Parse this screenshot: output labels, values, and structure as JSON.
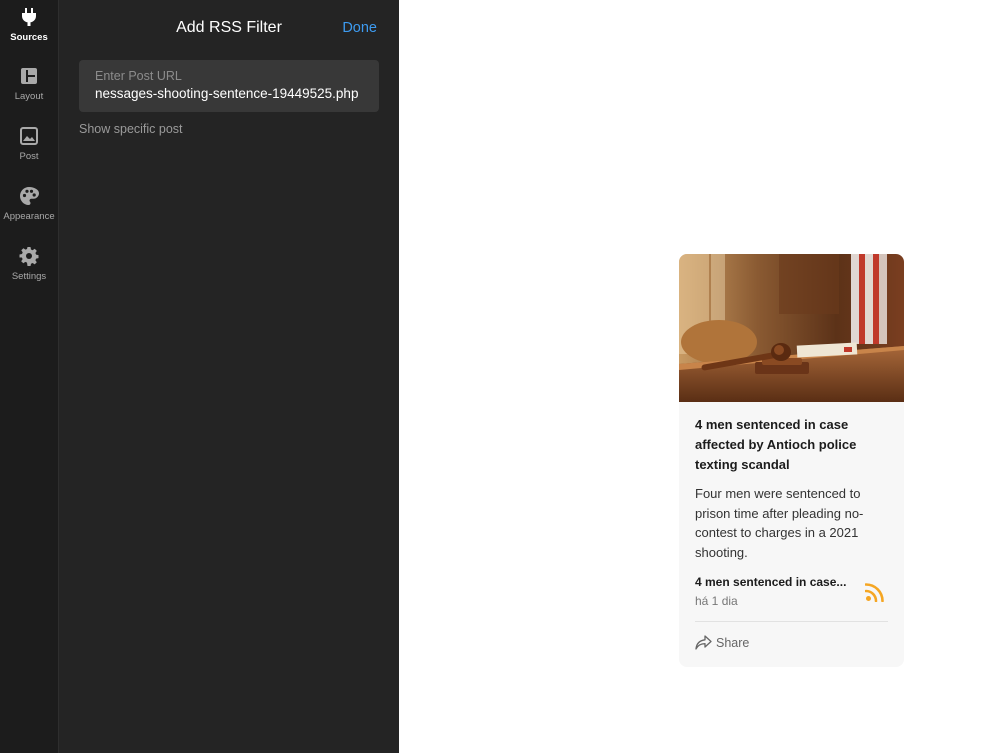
{
  "sidebar": {
    "items": [
      {
        "label": "Sources",
        "icon": "plug-icon",
        "active": true
      },
      {
        "label": "Layout",
        "icon": "layout-icon",
        "active": false
      },
      {
        "label": "Post",
        "icon": "image-icon",
        "active": false
      },
      {
        "label": "Appearance",
        "icon": "palette-icon",
        "active": false
      },
      {
        "label": "Settings",
        "icon": "gear-icon",
        "active": false
      }
    ]
  },
  "panel": {
    "title": "Add RSS Filter",
    "done_label": "Done",
    "url_field": {
      "label": "Enter Post URL",
      "value": "nessages-shooting-sentence-19449525.php"
    },
    "show_specific_post": "Show specific post"
  },
  "preview_card": {
    "title": "4 men sentenced in case affected by Antioch police texting scandal",
    "description": "Four men were sentenced to prison time after pleading no-contest to charges in a 2021 shooting.",
    "source_title": "4 men sentenced in case...",
    "time": "há 1 dia",
    "share_label": "Share",
    "source_icon": "rss-icon",
    "share_icon": "share-arrow-icon"
  },
  "colors": {
    "rail_background": "#1c1c1c",
    "panel_background": "#242424",
    "input_background": "#383838",
    "accent": "#3d9bf0",
    "rss_orange": "#f5a623"
  }
}
